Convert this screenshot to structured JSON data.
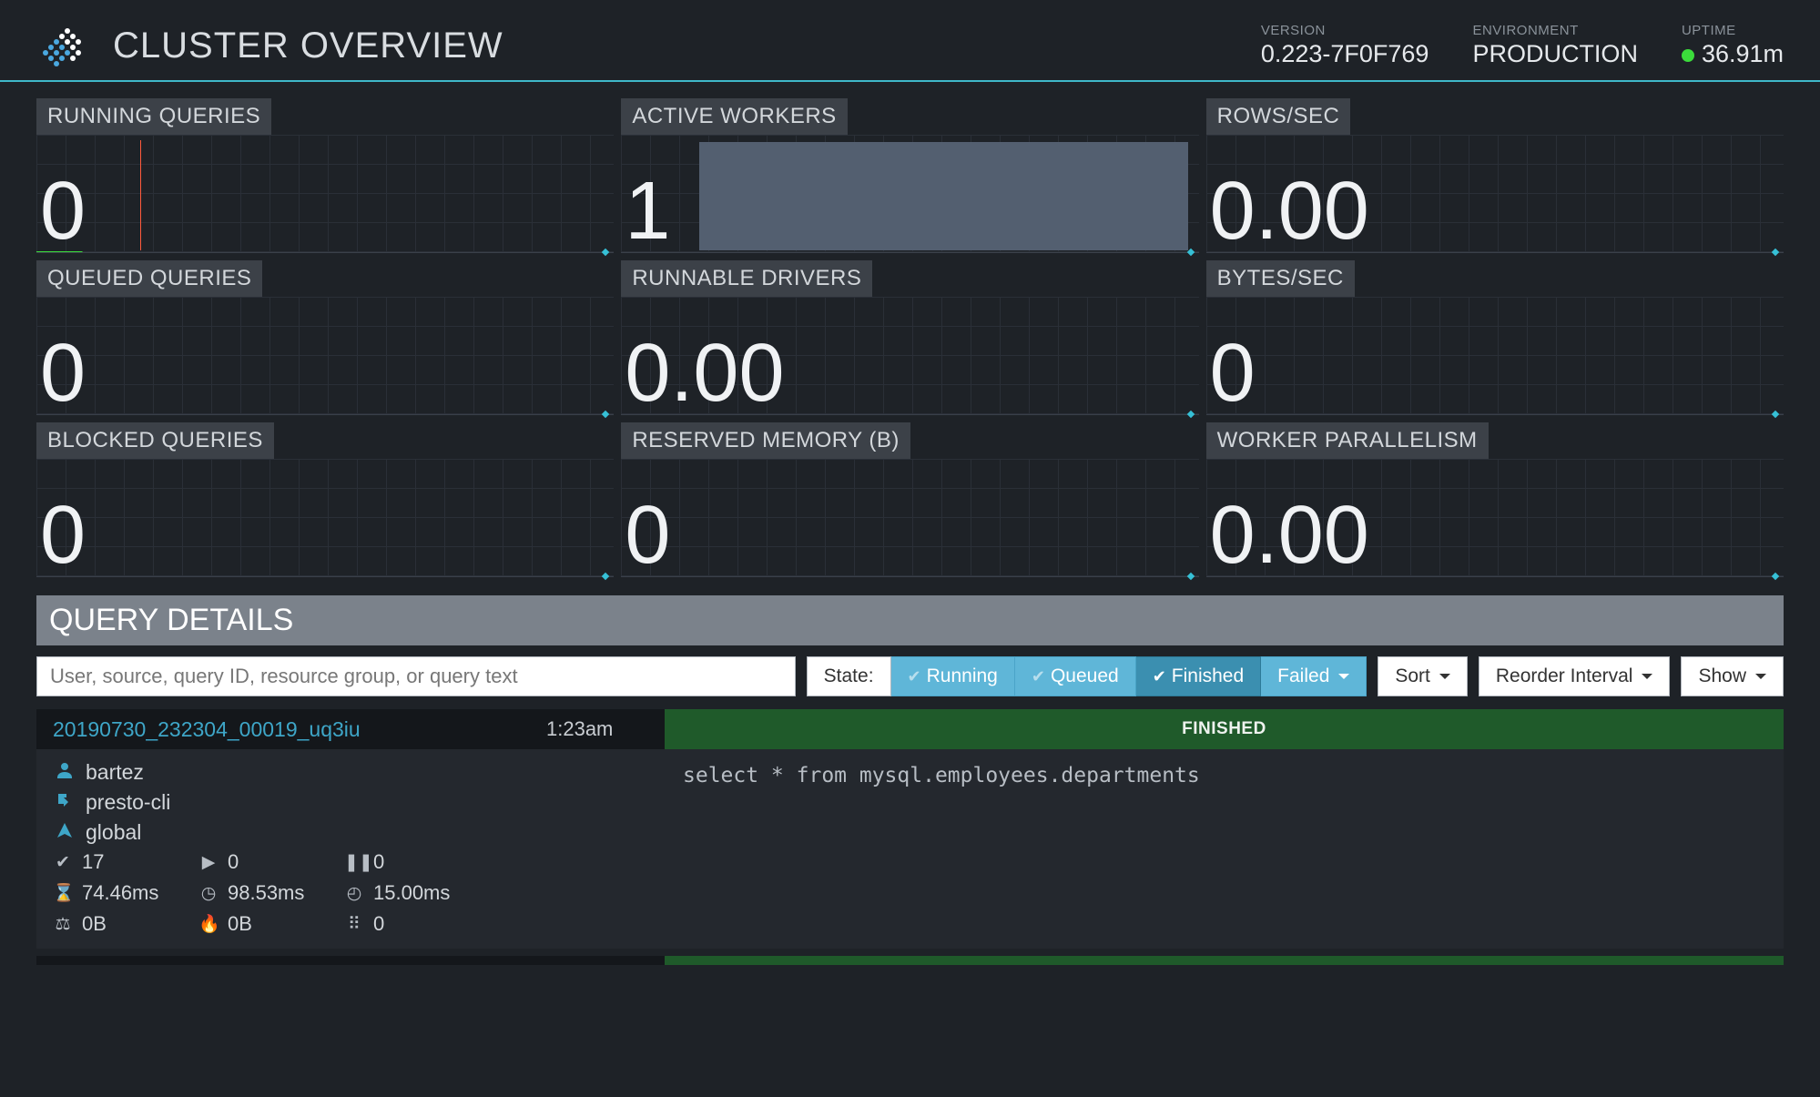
{
  "header": {
    "title": "CLUSTER OVERVIEW",
    "version_label": "VERSION",
    "version_value": "0.223-7F0F769",
    "environment_label": "ENVIRONMENT",
    "environment_value": "PRODUCTION",
    "uptime_label": "UPTIME",
    "uptime_value": "36.91m"
  },
  "metrics": {
    "running_queries": {
      "label": "RUNNING QUERIES",
      "value": "0"
    },
    "active_workers": {
      "label": "ACTIVE WORKERS",
      "value": "1"
    },
    "rows_per_sec": {
      "label": "ROWS/SEC",
      "value": "0.00"
    },
    "queued_queries": {
      "label": "QUEUED QUERIES",
      "value": "0"
    },
    "runnable_drivers": {
      "label": "RUNNABLE DRIVERS",
      "value": "0.00"
    },
    "bytes_per_sec": {
      "label": "BYTES/SEC",
      "value": "0"
    },
    "blocked_queries": {
      "label": "BLOCKED QUERIES",
      "value": "0"
    },
    "reserved_memory": {
      "label": "RESERVED MEMORY (B)",
      "value": "0"
    },
    "worker_parallelism": {
      "label": "WORKER PARALLELISM",
      "value": "0.00"
    }
  },
  "query_details": {
    "title": "QUERY DETAILS",
    "search_placeholder": "User, source, query ID, resource group, or query text",
    "state_label": "State:",
    "state_running": "Running",
    "state_queued": "Queued",
    "state_finished": "Finished",
    "state_failed": "Failed",
    "sort_label": "Sort",
    "reorder_label": "Reorder Interval",
    "show_label": "Show"
  },
  "queries": [
    {
      "id": "20190730_232304_00019_uq3iu",
      "time": "1:23am",
      "status": "FINISHED",
      "user": "bartez",
      "source": "presto-cli",
      "resource_group": "global",
      "completed_splits": "17",
      "running_splits": "0",
      "queued_splits": "0",
      "elapsed": "74.46ms",
      "cpu": "98.53ms",
      "planned": "15.00ms",
      "peak_memory": "0B",
      "cumulative_memory": "0B",
      "data_read": "0",
      "sql": "select * from mysql.employees.departments"
    }
  ]
}
